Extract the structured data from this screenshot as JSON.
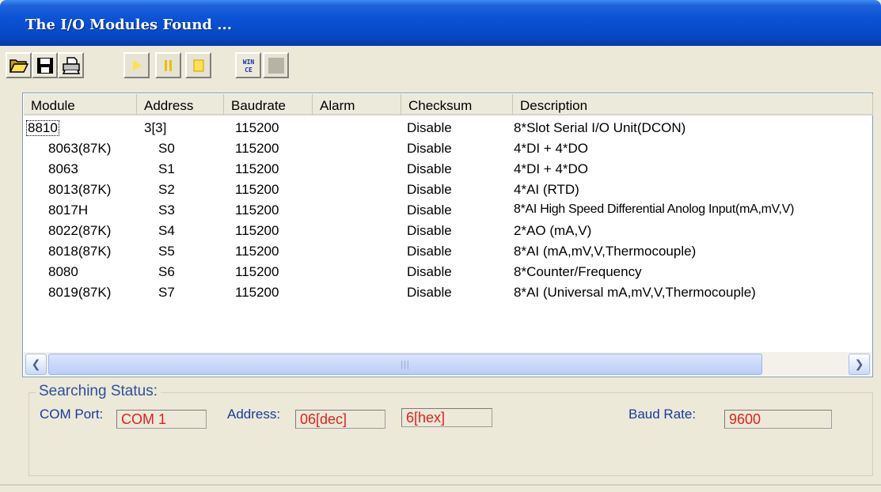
{
  "window": {
    "title": "The I/O Modules Found ..."
  },
  "toolbar": {
    "buttons": [
      {
        "icon": "open-folder-icon"
      },
      {
        "icon": "save-disk-icon"
      },
      {
        "icon": "printer-icon"
      },
      {
        "icon": "play-icon",
        "enabled": false
      },
      {
        "icon": "pause-icon",
        "enabled": false
      },
      {
        "icon": "stop-icon",
        "enabled": false
      },
      {
        "icon": "wince-icon",
        "label_line1": "WIN",
        "label_line2": "CE"
      },
      {
        "icon": "blank-icon",
        "enabled": false
      }
    ]
  },
  "table": {
    "columns": [
      "Module",
      "Address",
      "Baudrate",
      "Alarm",
      "Checksum",
      "Description"
    ],
    "rows": [
      {
        "module": "8810",
        "address": "3[3]",
        "baudrate": "115200",
        "alarm": "",
        "checksum": "Disable",
        "description": "8*Slot Serial I/O Unit(DCON)"
      },
      {
        "module": "8063(87K)",
        "address": "S0",
        "baudrate": "115200",
        "alarm": "",
        "checksum": "Disable",
        "description": "4*DI + 4*DO"
      },
      {
        "module": "8063",
        "address": "S1",
        "baudrate": "115200",
        "alarm": "",
        "checksum": "Disable",
        "description": "4*DI + 4*DO"
      },
      {
        "module": "8013(87K)",
        "address": "S2",
        "baudrate": "115200",
        "alarm": "",
        "checksum": "Disable",
        "description": "4*AI (RTD)"
      },
      {
        "module": "8017H",
        "address": "S3",
        "baudrate": "115200",
        "alarm": "",
        "checksum": "Disable",
        "description": "8*AI High Speed Differential Anolog Input(mA,mV,V)"
      },
      {
        "module": "8022(87K)",
        "address": "S4",
        "baudrate": "115200",
        "alarm": "",
        "checksum": "Disable",
        "description": "2*AO (mA,V)"
      },
      {
        "module": "8018(87K)",
        "address": "S5",
        "baudrate": "115200",
        "alarm": "",
        "checksum": "Disable",
        "description": "8*AI (mA,mV,V,Thermocouple)"
      },
      {
        "module": "8080",
        "address": "S6",
        "baudrate": "115200",
        "alarm": "",
        "checksum": "Disable",
        "description": "8*Counter/Frequency"
      },
      {
        "module": "8019(87K)",
        "address": "S7",
        "baudrate": "115200",
        "alarm": "",
        "checksum": "Disable",
        "description": "8*AI (Universal mA,mV,V,Thermocouple)"
      }
    ]
  },
  "status": {
    "legend": "Searching Status:",
    "com_port_label": "COM Port:",
    "com_port_value": "COM 1",
    "address_label": "Address:",
    "address_dec": "06[dec]",
    "address_hex": "6[hex]",
    "baud_rate_label": "Baud Rate:",
    "baud_rate_value": "9600"
  },
  "colors": {
    "title_bar": "#0a52d6",
    "status_label": "#1a3a9e",
    "status_value": "#e02020"
  }
}
